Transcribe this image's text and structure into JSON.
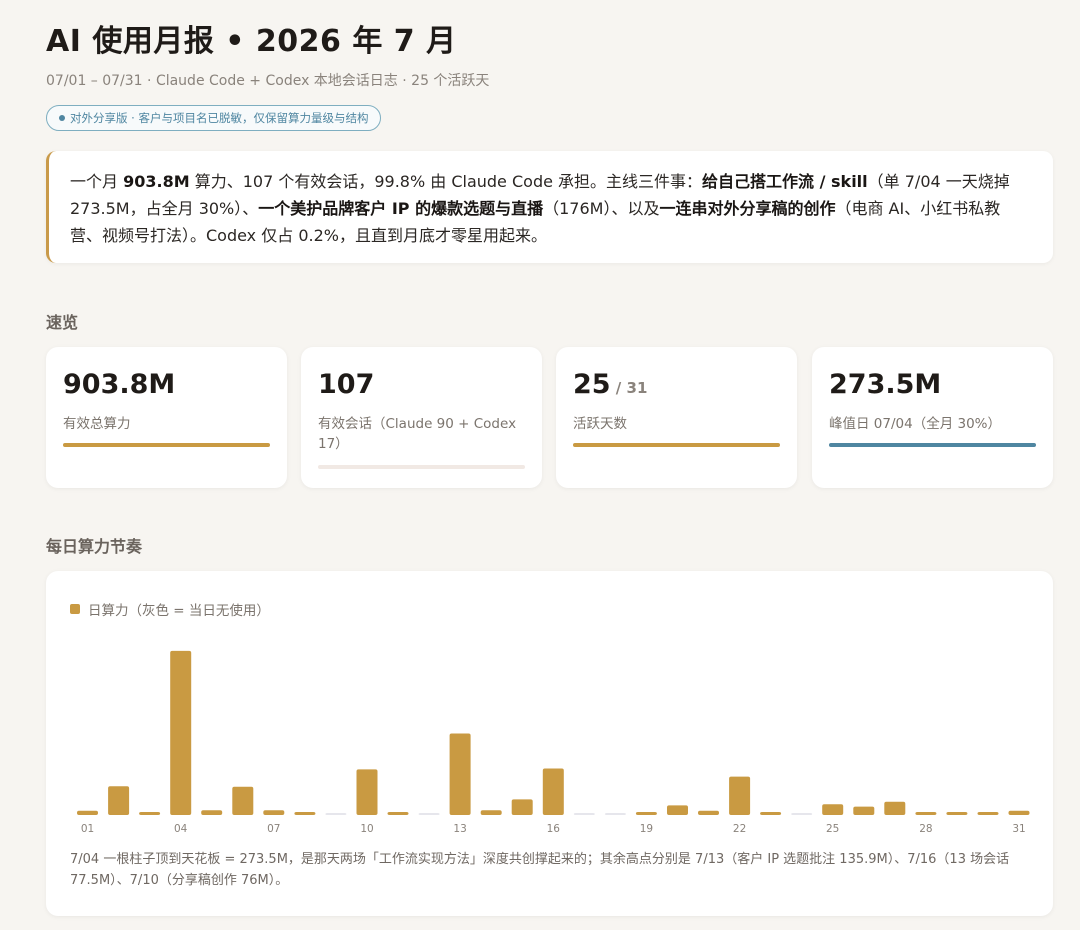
{
  "header": {
    "title": "AI 使用月报 • 2026 年 7 月",
    "subtitle": "07/01 – 07/31 · Claude Code + Codex 本地会话日志 · 25 个活跃天",
    "badge": "对外分享版 · 客户与项目名已脱敏，仅保留算力量级与结构"
  },
  "summary": {
    "parts": [
      {
        "text": "一个月 ",
        "bold": false
      },
      {
        "text": "903.8M",
        "bold": true
      },
      {
        "text": " 算力、107 个有效会话，99.8% 由 Claude Code 承担。主线三件事：",
        "bold": false
      },
      {
        "text": "给自己搭工作流 / skill",
        "bold": true
      },
      {
        "text": "（单 7/04 一天烧掉 273.5M，占全月 30%）、",
        "bold": false
      },
      {
        "text": "一个美护品牌客户 IP 的爆款选题与直播",
        "bold": true
      },
      {
        "text": "（176M）、以及",
        "bold": false
      },
      {
        "text": "一连串对外分享稿的创作",
        "bold": true
      },
      {
        "text": "（电商 AI、小红书私教营、视频号打法）。Codex 仅占 0.2%，且直到月底才零星用起来。",
        "bold": false
      }
    ]
  },
  "overview": {
    "section_title": "速览",
    "cards": [
      {
        "value": "903.8M",
        "denom": "",
        "label": "有效总算力",
        "bar_color": "#c99a42",
        "bar_style": "solid"
      },
      {
        "value": "107",
        "denom": "",
        "label": "有效会话（Claude 90 + Codex 17）",
        "bar_color": "#f1e9e4",
        "bar_style": "light"
      },
      {
        "value": "25",
        "denom": " / 31",
        "label": "活跃天数",
        "bar_color": "#c99a42",
        "bar_style": "solid"
      },
      {
        "value": "273.5M",
        "denom": "",
        "label": "峰值日 07/04（全月 30%）",
        "bar_color": "#4f86a1",
        "bar_style": "solid"
      }
    ]
  },
  "daily": {
    "section_title": "每日算力节奏",
    "legend": "日算力（灰色 = 当日无使用）",
    "note": "7/04 一根柱子顶到天花板 = 273.5M，是那天两场「工作流实现方法」深度共创撑起来的；其余高点分别是 7/13（客户 IP 选题批注 135.9M）、7/16（13 场会话 77.5M）、7/10（分享稿创作 76M）。"
  },
  "colors": {
    "accent": "#c99a42",
    "blue": "#4f86a1",
    "empty_day": "#e6e6ec"
  },
  "chart_data": {
    "type": "bar",
    "title": "",
    "xlabel": "",
    "ylabel": "",
    "unit": "M",
    "x": [
      "01",
      "02",
      "03",
      "04",
      "05",
      "06",
      "07",
      "08",
      "09",
      "10",
      "11",
      "12",
      "13",
      "14",
      "15",
      "16",
      "17",
      "18",
      "19",
      "20",
      "21",
      "22",
      "23",
      "24",
      "25",
      "26",
      "27",
      "28",
      "29",
      "30",
      "31"
    ],
    "tick_labels": [
      "01",
      "04",
      "07",
      "10",
      "13",
      "16",
      "19",
      "22",
      "25",
      "28",
      "31"
    ],
    "series": [
      {
        "name": "日算力",
        "values": [
          7,
          48,
          3,
          273.5,
          8,
          47,
          8,
          3,
          0,
          76,
          3,
          0,
          135.9,
          8,
          26,
          77.5,
          0,
          0,
          1,
          16,
          7,
          64,
          3,
          0,
          18,
          14,
          22,
          4,
          4,
          3,
          7
        ]
      }
    ],
    "empty_days": [
      "09",
      "12",
      "17",
      "18",
      "24"
    ],
    "ylim": [
      0,
      280
    ],
    "grid": false,
    "legend_position": "top-left"
  }
}
